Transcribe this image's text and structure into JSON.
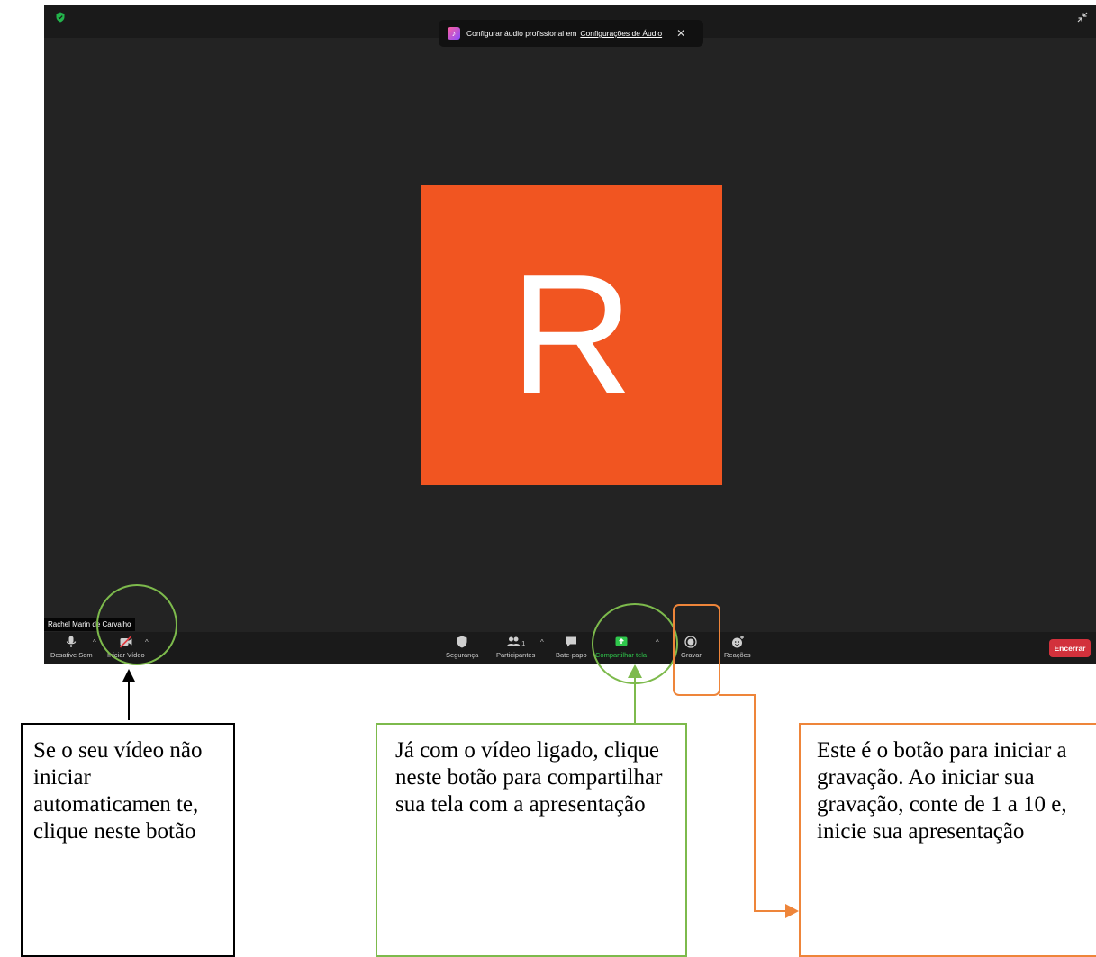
{
  "banner": {
    "text": "Configurar áudio profissional em",
    "link": "Configurações de Áudio",
    "close": "✕"
  },
  "participant": {
    "initial": "R",
    "name": "Rachel Marin de Carvalho",
    "avatar_color": "#f15521"
  },
  "toolbar": {
    "mute_label": "Desative Som",
    "video_label": "Iniciar Vídeo",
    "security_label": "Segurança",
    "participants_label": "Participantes",
    "participants_count": "1",
    "chat_label": "Bate-papo",
    "share_label": "Compartilhar tela",
    "record_label": "Gravar",
    "reactions_label": "Reações",
    "end_label": "Encerrar",
    "share_color": "#2fc84c",
    "end_color": "#d2313c"
  },
  "icons": [
    "shield-icon",
    "exit-fullscreen-icon",
    "microphone-icon",
    "video-off-icon",
    "security-shield-icon",
    "participants-icon",
    "chat-icon",
    "share-screen-icon",
    "record-icon",
    "reactions-icon"
  ],
  "annotations": {
    "video_tip": "Se o seu vídeo não iniciar automaticamen te, clique neste botão",
    "share_tip": "Já com o vídeo ligado, clique neste botão para compartilhar sua tela com a apresentação",
    "record_tip": "Este é o botão para iniciar a gravação. Ao iniciar sua gravação, conte de 1 a 10 e, inicie sua apresentação",
    "colors": {
      "video": "#000000",
      "share": "#7dba4c",
      "record": "#ee853a"
    }
  }
}
